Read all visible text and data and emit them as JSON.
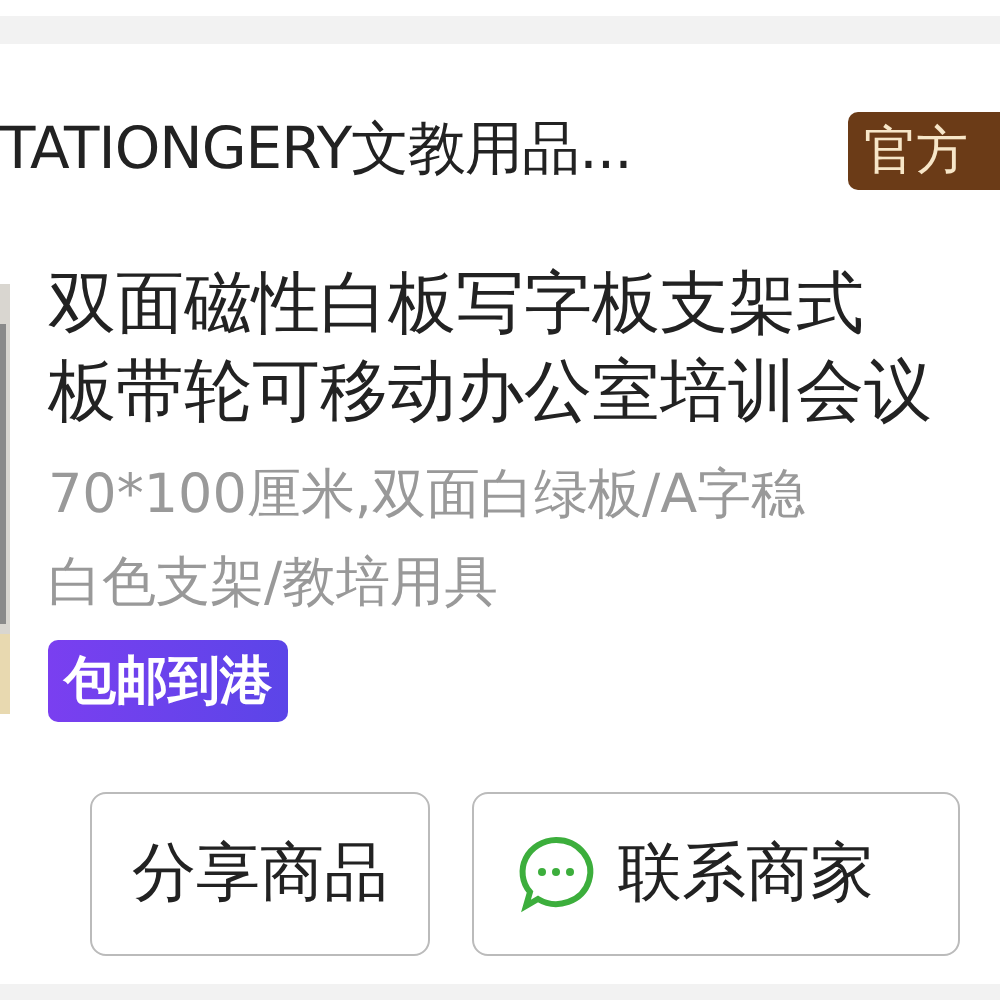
{
  "shop": {
    "name": "TATIONGERY文教用品...",
    "badge": "官方"
  },
  "product": {
    "kind": "picture",
    "title_lines": [
      "双面磁性白板写字板支架式",
      "板带轮可移动办公室培训会议"
    ],
    "spec_lines": [
      "70*100厘米,双面白绿板/A字稳",
      "白色支架/教培用具"
    ],
    "tag": "包邮到港"
  },
  "buttons": [
    {
      "label": "分享商品",
      "kind": "plain"
    },
    {
      "label": "联系商家",
      "kind": "chat"
    }
  ]
}
